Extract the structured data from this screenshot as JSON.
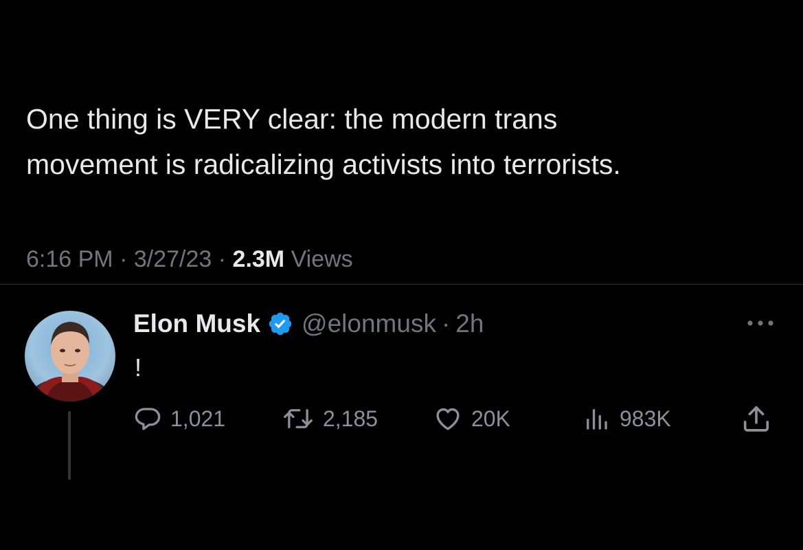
{
  "main_tweet": {
    "text_lines": [
      "One thing is VERY clear: the modern trans",
      "movement is radicalizing activists into terrorists."
    ],
    "time": "6:16 PM",
    "date": "3/27/23",
    "separator": "·",
    "views_count": "2.3M",
    "views_label": "Views"
  },
  "reply": {
    "author_name": "Elon Musk",
    "handle": "@elonmusk",
    "separator": "·",
    "time": "2h",
    "text": "!",
    "verified_color": "#1d9bf0",
    "actions": {
      "replies": "1,021",
      "retweets": "2,185",
      "likes": "20K",
      "views": "983K"
    }
  },
  "icons": {
    "verified": "verified-badge-icon",
    "more": "more-dots-icon",
    "reply": "speech-bubble-icon",
    "retweet": "retweet-arrows-icon",
    "like": "heart-icon",
    "views": "bar-chart-icon",
    "share": "share-upload-icon"
  },
  "colors": {
    "background": "#000000",
    "primary_text": "#e7e9ea",
    "secondary_text": "#71767b",
    "divider": "#2f3336"
  }
}
